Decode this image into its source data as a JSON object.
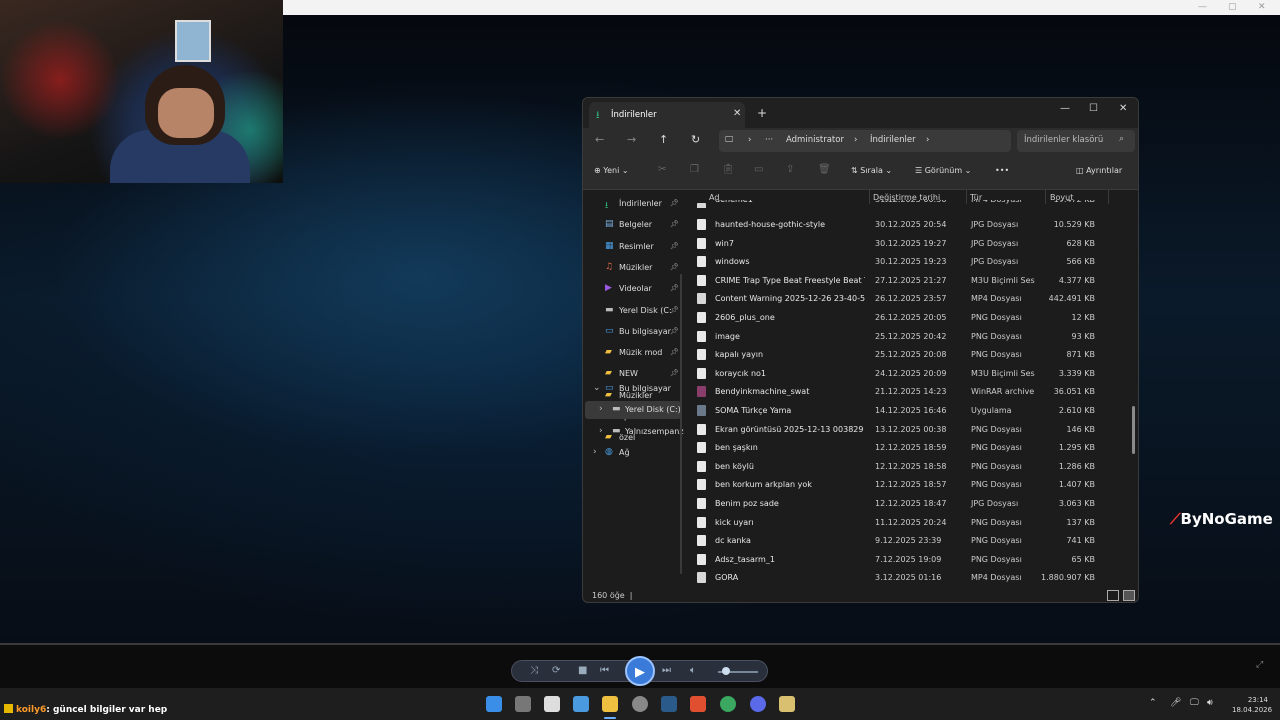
{
  "explorer": {
    "tab_title": "İndirilenler",
    "address": {
      "seg1": "Administrator",
      "seg2": "İndirilenler"
    },
    "search_placeholder": "İndirilenler klasörü",
    "commands": {
      "new": "Yeni",
      "sort": "Sırala",
      "view": "Görünüm",
      "more": "•••",
      "details": "Ayrıntılar"
    },
    "sidebar": {
      "quick": [
        {
          "label": "İndirilenler",
          "icon": "download-icon",
          "color": "#2fb87a"
        },
        {
          "label": "Belgeler",
          "icon": "documents-icon",
          "color": "#7ab0e0"
        },
        {
          "label": "Resimler",
          "icon": "pictures-icon",
          "color": "#4aa0e8"
        },
        {
          "label": "Müzikler",
          "icon": "music-icon",
          "color": "#e06a4a"
        },
        {
          "label": "Videolar",
          "icon": "videos-icon",
          "color": "#9a5ae0"
        },
        {
          "label": "Yerel Disk (C:",
          "icon": "drive-icon",
          "color": "#bbbbbb"
        },
        {
          "label": "Bu bilgisayar",
          "icon": "computer-icon",
          "color": "#4aa0e8"
        },
        {
          "label": "Müzik mod",
          "icon": "folder-icon",
          "color": "#f0c040"
        },
        {
          "label": "NEW",
          "icon": "folder-icon",
          "color": "#f0c040"
        },
        {
          "label": "Müzikler",
          "icon": "folder-icon",
          "color": "#f0c040"
        },
        {
          "label": "Epic Games",
          "icon": "folder-icon",
          "color": "#f0c040"
        },
        {
          "label": "özel",
          "icon": "folder-icon",
          "color": "#f0c040"
        }
      ],
      "tree": [
        {
          "label": "Bu bilgisayar"
        },
        {
          "label": "Yerel Disk (C:)"
        },
        {
          "label": "Yalnızsempanz"
        },
        {
          "label": "Ağ"
        }
      ]
    },
    "columns": {
      "name": "Ad",
      "date": "Değiştirme tarihi",
      "type": "Tür",
      "size": "Boyut"
    },
    "files": [
      {
        "name": "deneme1",
        "date": "31.12.2025 00:36",
        "type": "MP4 Dosyası",
        "size": "17.472 KB",
        "kind": "mp4"
      },
      {
        "name": "haunted-house-gothic-style",
        "date": "30.12.2025 20:54",
        "type": "JPG Dosyası",
        "size": "10.529 KB",
        "kind": "img"
      },
      {
        "name": "win7",
        "date": "30.12.2025 19:27",
        "type": "JPG Dosyası",
        "size": "628 KB",
        "kind": "img"
      },
      {
        "name": "windows",
        "date": "30.12.2025 19:23",
        "type": "JPG Dosyası",
        "size": "566 KB",
        "kind": "img"
      },
      {
        "name": "CRIME  Trap Type Beat  Freestyle Beat  Ty...",
        "date": "27.12.2025 21:27",
        "type": "M3U Biçimli Ses",
        "size": "4.377 KB",
        "kind": "img"
      },
      {
        "name": "Content Warning 2025-12-26 23-40-58",
        "date": "26.12.2025 23:57",
        "type": "MP4 Dosyası",
        "size": "442.491 KB",
        "kind": "mp4"
      },
      {
        "name": "2606_plus_one",
        "date": "26.12.2025 20:05",
        "type": "PNG Dosyası",
        "size": "12 KB",
        "kind": "img"
      },
      {
        "name": "image",
        "date": "25.12.2025 20:42",
        "type": "PNG Dosyası",
        "size": "93 KB",
        "kind": "img"
      },
      {
        "name": "kapalı yayın",
        "date": "25.12.2025 20:08",
        "type": "PNG Dosyası",
        "size": "871 KB",
        "kind": "img"
      },
      {
        "name": "koraycık no1",
        "date": "24.12.2025 20:09",
        "type": "M3U Biçimli Ses",
        "size": "3.339 KB",
        "kind": "img"
      },
      {
        "name": "Bendyinkmachine_swat",
        "date": "21.12.2025 14:23",
        "type": "WinRAR archive",
        "size": "36.051 KB",
        "kind": "rar"
      },
      {
        "name": "SOMA Türkçe Yama",
        "date": "14.12.2025 16:46",
        "type": "Uygulama",
        "size": "2.610 KB",
        "kind": "exe"
      },
      {
        "name": "Ekran görüntüsü 2025-12-13 003829",
        "date": "13.12.2025 00:38",
        "type": "PNG Dosyası",
        "size": "146 KB",
        "kind": "img"
      },
      {
        "name": "ben şaşkın",
        "date": "12.12.2025 18:59",
        "type": "PNG Dosyası",
        "size": "1.295 KB",
        "kind": "img"
      },
      {
        "name": "ben köylü",
        "date": "12.12.2025 18:58",
        "type": "PNG Dosyası",
        "size": "1.286 KB",
        "kind": "img"
      },
      {
        "name": "ben korkum arkplan yok",
        "date": "12.12.2025 18:57",
        "type": "PNG Dosyası",
        "size": "1.407 KB",
        "kind": "img"
      },
      {
        "name": "Benim poz sade",
        "date": "12.12.2025 18:47",
        "type": "JPG Dosyası",
        "size": "3.063 KB",
        "kind": "img"
      },
      {
        "name": "kick uyarı",
        "date": "11.12.2025 20:24",
        "type": "PNG Dosyası",
        "size": "137 KB",
        "kind": "img"
      },
      {
        "name": "dc kanka",
        "date": "9.12.2025 23:39",
        "type": "PNG Dosyası",
        "size": "741 KB",
        "kind": "img"
      },
      {
        "name": "Adsz_tasarm_1",
        "date": "7.12.2025 19:09",
        "type": "PNG Dosyası",
        "size": "65 KB",
        "kind": "img"
      },
      {
        "name": "GORA",
        "date": "3.12.2025 01:16",
        "type": "MP4 Dosyası",
        "size": "1.880.907 KB",
        "kind": "mp4"
      }
    ],
    "status": {
      "count": "160 öğe"
    }
  },
  "overlay": {
    "logo": "ByNoGame"
  },
  "chat": {
    "user": "koily6",
    "message": ": güncel bilgiler var hep"
  },
  "taskbar": {
    "time": "23:14",
    "date": "18.04.2026"
  }
}
